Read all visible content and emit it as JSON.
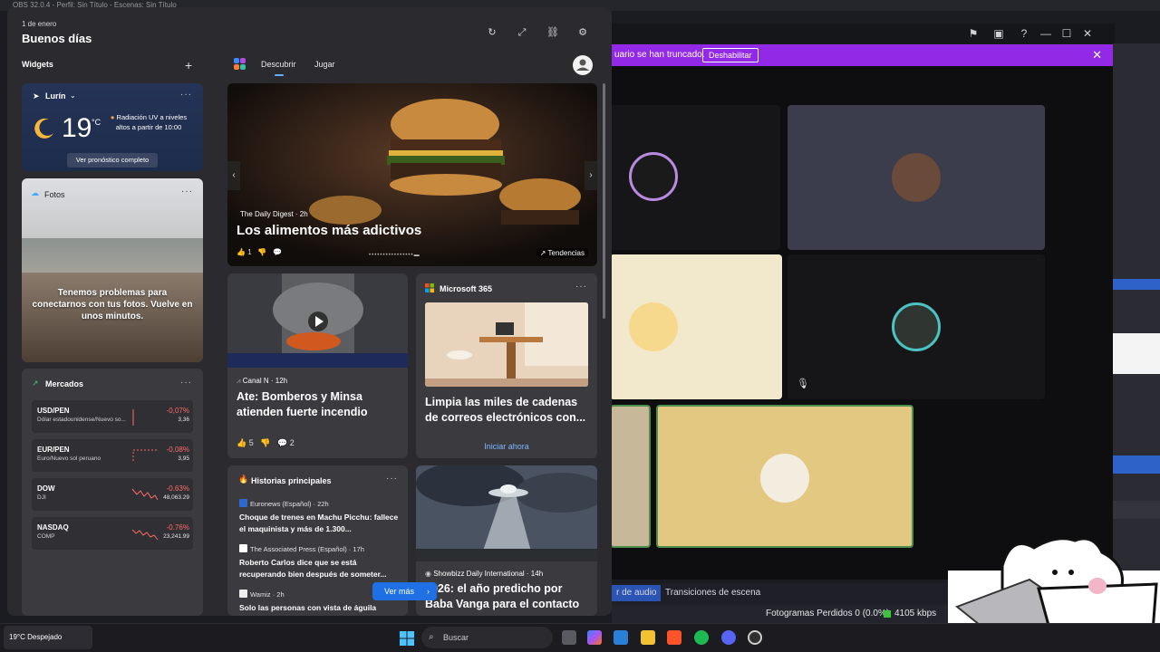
{
  "obs": {
    "title": "OBS 32.0.4 - Perfil: Sin Título - Escenas: Sin Título",
    "banner_text": "uario se han truncado.",
    "banner_button": "Deshabilitar",
    "tab_audio": "r de audio",
    "tab_transitions": "Transiciones de escena",
    "dropped_frames": "Fotogramas Perdidos 0 (0.0%)",
    "bitrate": "4105 kbps"
  },
  "widgets": {
    "date": "1 de enero",
    "greeting": "Buenos días",
    "section_title": "Widgets",
    "tabs": [
      "Descubrir",
      "Jugar"
    ],
    "weather": {
      "location": "Lurín",
      "temperature": "19",
      "unit": "°C",
      "uv_alert": "Radiación UV a niveles altos a partir de 10:00",
      "forecast_link": "Ver pronóstico completo"
    },
    "photos": {
      "title": "Fotos",
      "message": "Tenemos problemas para conectarnos con tus fotos. Vuelve en unos minutos."
    },
    "markets": {
      "title": "Mercados",
      "rows": [
        {
          "symbol": "USD/PEN",
          "name": "Dólar estadounidense/Nuevo so...",
          "change": "-0,07%",
          "value": "3,36"
        },
        {
          "symbol": "EUR/PEN",
          "name": "Euro/Nuevo sol peruano",
          "change": "-0,08%",
          "value": "3,95"
        },
        {
          "symbol": "DOW",
          "name": "DJI",
          "change": "-0.63%",
          "value": "48,063.29"
        },
        {
          "symbol": "NASDAQ",
          "name": "COMP",
          "change": "-0.76%",
          "value": "23,241.99"
        }
      ]
    },
    "hero": {
      "source": "The Daily Digest · 2h",
      "title": "Los alimentos más adictivos",
      "likes": "1",
      "trend_label": "Tendencias"
    },
    "news1": {
      "source": "Canal N · 12h",
      "title": "Ate: Bomberos y Minsa atienden fuerte incendio",
      "likes": "5",
      "comments": "2"
    },
    "m365": {
      "title": "Microsoft 365",
      "text": "Limpia las miles de cadenas de correos electrónicos con...",
      "link": "Iniciar ahora"
    },
    "top_stories": {
      "title": "Historias principales",
      "items": [
        {
          "source": "Euronews (Español) · 22h",
          "title": "Choque de trenes en Machu Picchu: fallece el maquinista y más de 1.300..."
        },
        {
          "source": "The Associated Press (Español) · 17h",
          "title": "Roberto Carlos dice que se está recuperando bien después de someter..."
        },
        {
          "source": "Wamiz · 2h",
          "title": "Solo las personas con vista de águila"
        }
      ]
    },
    "ufo": {
      "source": "Showbizz Daily International · 14h",
      "title": "2026: el año predicho por Baba Vanga para el contacto"
    },
    "more_button": "Ver más"
  },
  "taskbar": {
    "weather": "19°C Despejado",
    "search_placeholder": "Buscar"
  },
  "colors": {
    "panel_bg": "#2b2b2f",
    "card_bg": "#3a3a3f",
    "accent_blue": "#1f6fe5",
    "negative_red": "#ff6b6b",
    "banner_purple": "#9229e6"
  }
}
